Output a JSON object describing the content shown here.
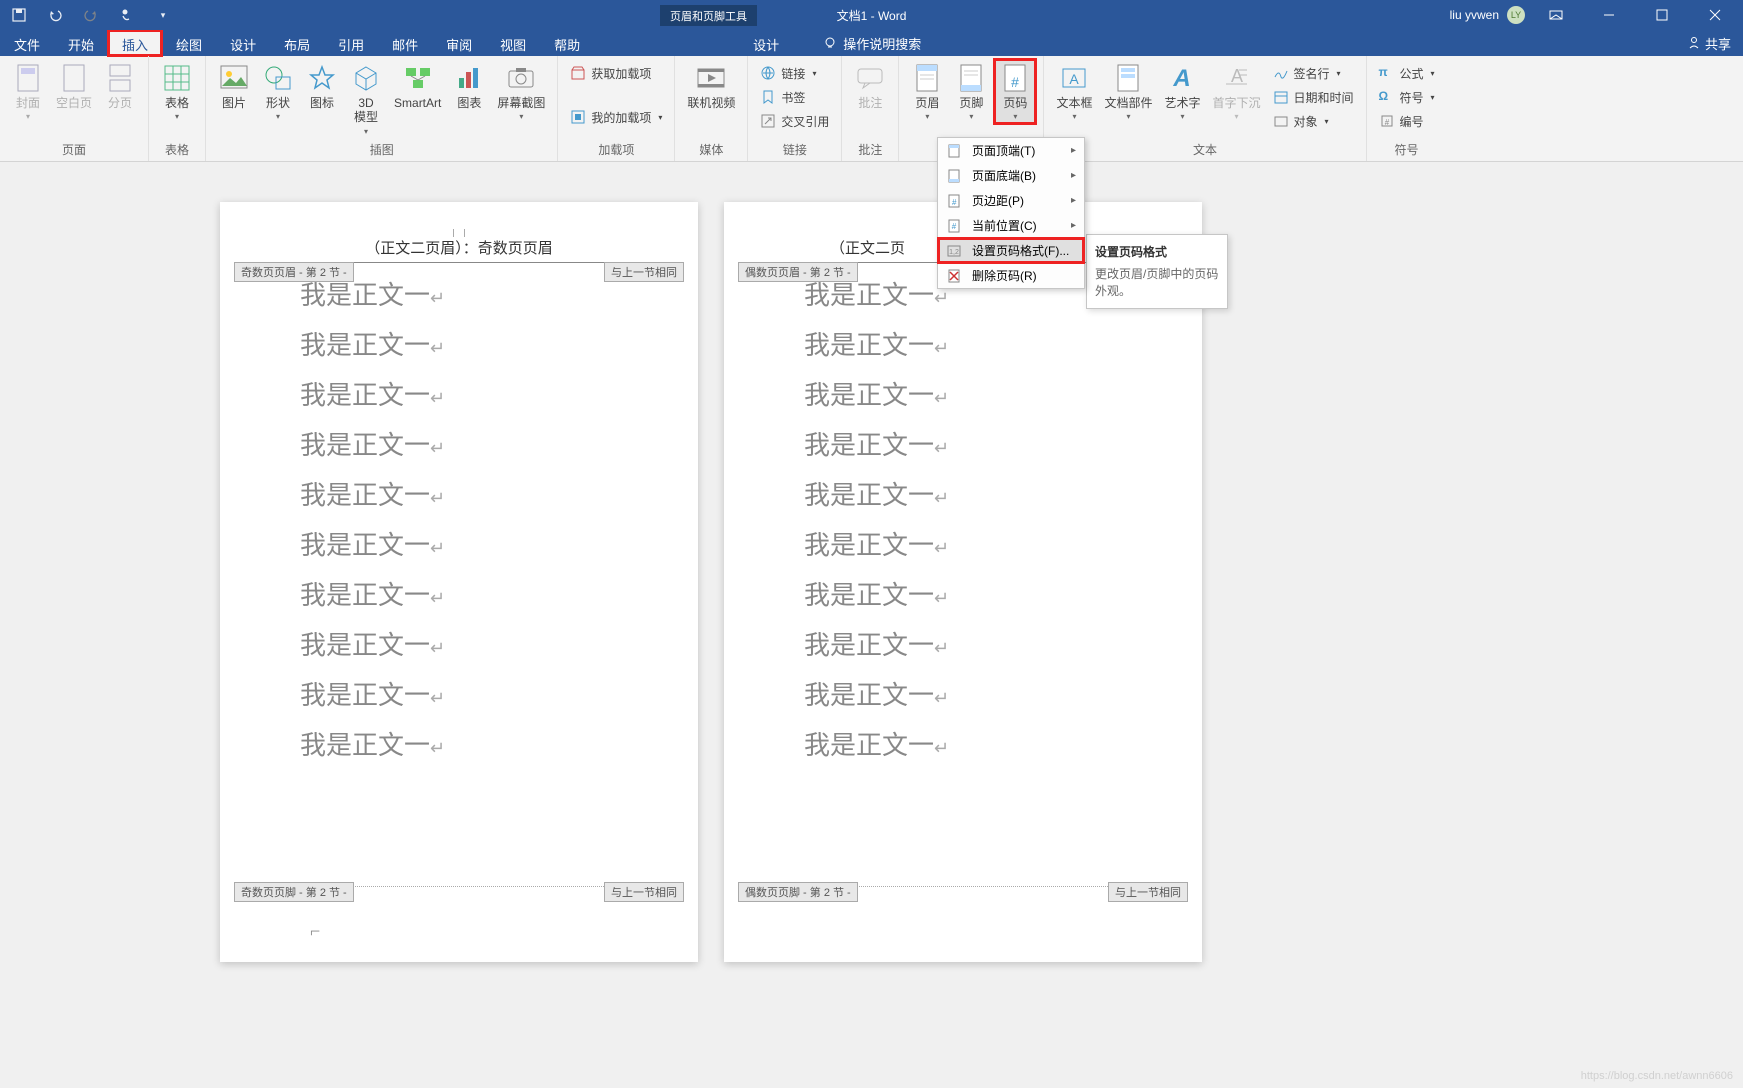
{
  "title_bar": {
    "doc_title": "文档1 - Word",
    "tool_context": "页眉和页脚工具",
    "user_name": "liu yvwen",
    "avatar_initials": "LY"
  },
  "tabs": {
    "file": "文件",
    "home": "开始",
    "insert": "插入",
    "draw": "绘图",
    "design": "设计",
    "layout": "布局",
    "references": "引用",
    "mail": "邮件",
    "review": "审阅",
    "view": "视图",
    "help": "帮助",
    "hf_design": "设计",
    "tell_me": "操作说明搜索",
    "share": "共享"
  },
  "ribbon": {
    "pages": {
      "label": "页面",
      "cover": "封面",
      "blank": "空白页",
      "break": "分页"
    },
    "tables": {
      "label": "表格",
      "table": "表格"
    },
    "illus": {
      "label": "插图",
      "pic": "图片",
      "shapes": "形状",
      "icons": "图标",
      "model": "3D\n模型",
      "smartart": "SmartArt",
      "chart": "图表",
      "screenshot": "屏幕截图"
    },
    "addins": {
      "label": "加载项",
      "get": "获取加载项",
      "my": "我的加载项"
    },
    "media": {
      "label": "媒体",
      "video": "联机视频"
    },
    "links": {
      "label": "链接",
      "link": "链接",
      "bookmark": "书签",
      "crossref": "交叉引用"
    },
    "comments": {
      "label": "批注",
      "comment": "批注"
    },
    "hf": {
      "label": "页眉和页脚",
      "header": "页眉",
      "footer": "页脚",
      "pagenum": "页码"
    },
    "text": {
      "label": "文本",
      "textbox": "文本框",
      "parts": "文档部件",
      "wordart": "艺术字",
      "dropcap": "首字下沉",
      "sig": "签名行",
      "datetime": "日期和时间",
      "object": "对象"
    },
    "symbols": {
      "label": "符号",
      "eq": "公式",
      "sym": "符号",
      "num": "编号"
    }
  },
  "menu": {
    "top": "页面顶端(T)",
    "bottom": "页面底端(B)",
    "margin": "页边距(P)",
    "current": "当前位置(C)",
    "format": "设置页码格式(F)...",
    "remove": "删除页码(R)"
  },
  "tooltip": {
    "title": "设置页码格式",
    "body": "更改页眉/页脚中的页码外观。"
  },
  "doc": {
    "header_left": "（正文二页眉）：奇数页页眉",
    "header_right_prefix": "（正文二页",
    "marker_odd_header": "奇数页页眉 - 第 2 节 -",
    "marker_even_header": "偶数页页眉 - 第 2 节 -",
    "marker_odd_footer": "奇数页页脚 - 第 2 节 -",
    "marker_even_footer": "偶数页页脚 - 第 2 节 -",
    "marker_same": "与上一节相同",
    "body_line": "我是正文一",
    "body_count": 10
  },
  "watermark": "https://blog.csdn.net/awnn6606"
}
